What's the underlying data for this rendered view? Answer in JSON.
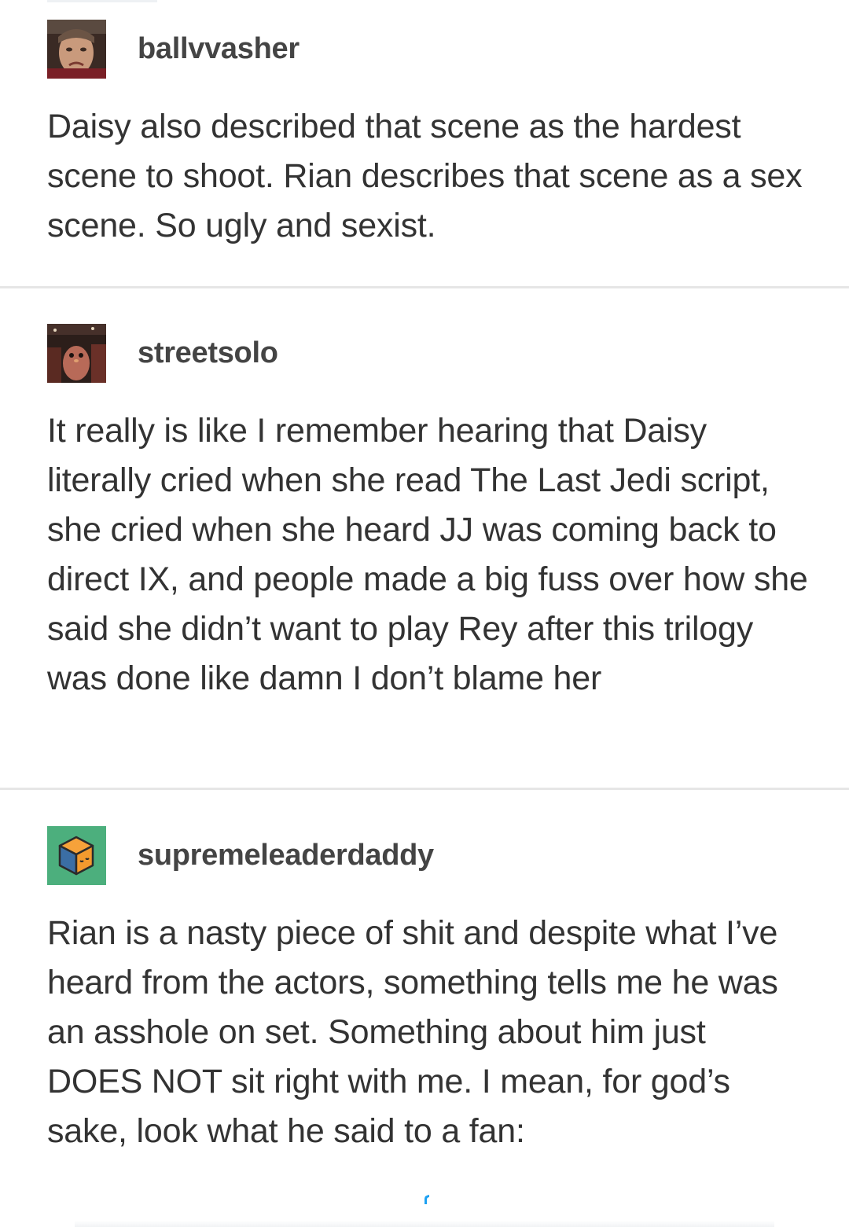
{
  "posts": [
    {
      "username": "ballvvasher",
      "avatar_icon": "photo-avatar-man",
      "body": "Daisy also described that scene as the hardest scene to shoot. Rian describes that scene as a sex scene. So ugly and sexist."
    },
    {
      "username": "streetsolo",
      "avatar_icon": "photo-avatar-porg",
      "body": "It really is like I remember hearing that Daisy literally cried when she read The Last Jedi script, she cried when she heard JJ was coming back to direct IX, and people made a big fuss over how she said she didn’t want to play Rey after this trilogy was done like damn I don’t blame her"
    },
    {
      "username": "supremeleaderdaddy",
      "avatar_icon": "cube-avatar-icon",
      "body": "Rian is a nasty piece of shit and despite what I’ve heard from the actors, something tells me he was an asshole on set. Something about him just DOES NOT sit right with me. I mean, for god’s sake, look what he said to a fan:"
    }
  ],
  "colors": {
    "text": "#333333",
    "username": "#444444",
    "divider": "#e6e6e6",
    "cube_avatar_bg": "#4caf7d",
    "embed_accent": "#1da1f2"
  }
}
